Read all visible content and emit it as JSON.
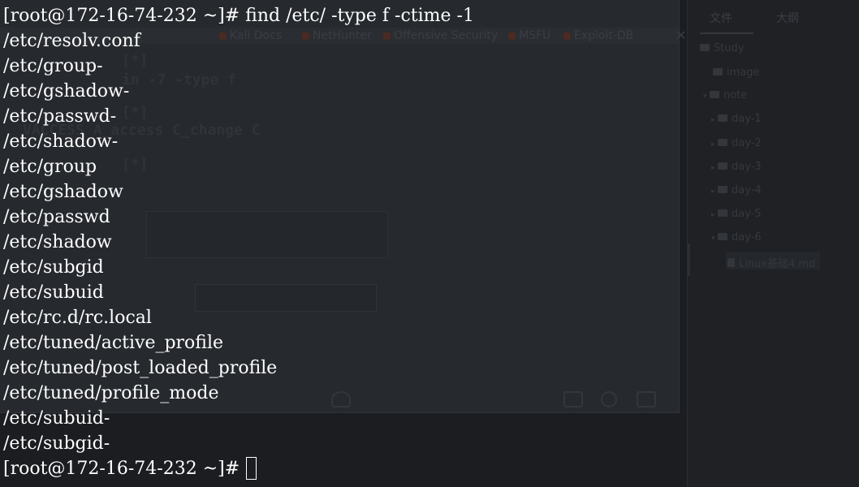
{
  "terminal": {
    "prompt": "[root@172-16-74-232 ~]#",
    "command": "find /etc/ -type f -ctime -1",
    "output": [
      "/etc/resolv.conf",
      "/etc/group-",
      "/etc/gshadow-",
      "/etc/passwd-",
      "/etc/shadow-",
      "/etc/group",
      "/etc/gshadow",
      "/etc/passwd",
      "/etc/shadow",
      "/etc/subgid",
      "/etc/subuid",
      "/etc/rc.d/rc.local",
      "/etc/tuned/active_profile",
      "/etc/tuned/post_loaded_profile",
      "/etc/tuned/profile_mode",
      "/etc/subuid-",
      "/etc/subgid-"
    ],
    "final_prompt": "[root@172-16-74-232 ~]#"
  },
  "background": {
    "bookmarks": [
      "Kali Docs",
      "NetHunter",
      "Offensive Security",
      "MSFU",
      "Exploit-DB"
    ],
    "ghost_lines": [
      "[*]",
      "in -7 -type f",
      "[*]",
      "VACCESS A_access C_change C",
      "[*]"
    ],
    "sidebar_tabs": [
      "文件",
      "大纲"
    ],
    "tree": [
      {
        "label": "Study",
        "kind": "folder"
      },
      {
        "label": "image",
        "kind": "folder"
      },
      {
        "label": "note",
        "kind": "folder"
      },
      {
        "label": "day-1",
        "kind": "folder"
      },
      {
        "label": "day-2",
        "kind": "folder"
      },
      {
        "label": "day-3",
        "kind": "folder"
      },
      {
        "label": "day-4",
        "kind": "folder"
      },
      {
        "label": "day-5",
        "kind": "folder"
      },
      {
        "label": "day-6",
        "kind": "folder"
      },
      {
        "label": "Linux基础4.md",
        "kind": "file"
      }
    ]
  }
}
